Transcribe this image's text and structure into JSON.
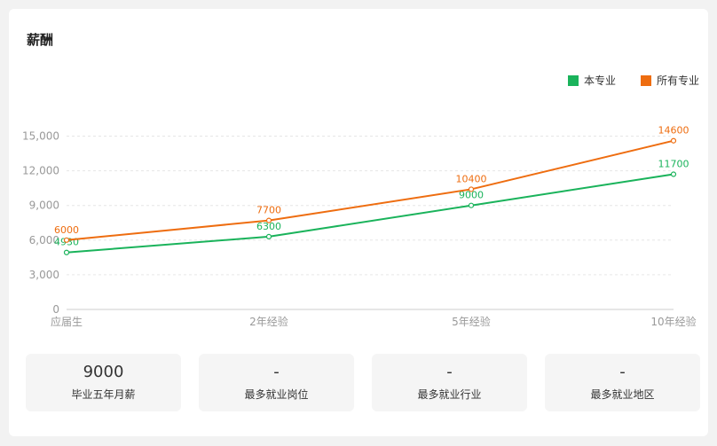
{
  "section": {
    "title": "薪酬"
  },
  "legend": [
    {
      "label": "本专业",
      "color": "#1ab35b"
    },
    {
      "label": "所有专业",
      "color": "#ee6d10"
    }
  ],
  "chart_data": {
    "type": "line",
    "categories": [
      "应届生",
      "2年经验",
      "5年经验",
      "10年经验"
    ],
    "series": [
      {
        "name": "本专业",
        "color": "#1ab35b",
        "values": [
          4930,
          6300,
          9000,
          11700
        ]
      },
      {
        "name": "所有专业",
        "color": "#ee6d10",
        "values": [
          6000,
          7700,
          10400,
          14600
        ]
      }
    ],
    "y_ticks": [
      "0",
      "3,000",
      "6,000",
      "9,000",
      "12,000",
      "15,000"
    ],
    "ylim": [
      0,
      15000
    ],
    "grid": true,
    "legend_position": "top-right"
  },
  "stats": [
    {
      "value": "9000",
      "label": "毕业五年月薪"
    },
    {
      "value": "-",
      "label": "最多就业岗位"
    },
    {
      "value": "-",
      "label": "最多就业行业"
    },
    {
      "value": "-",
      "label": "最多就业地区"
    }
  ]
}
